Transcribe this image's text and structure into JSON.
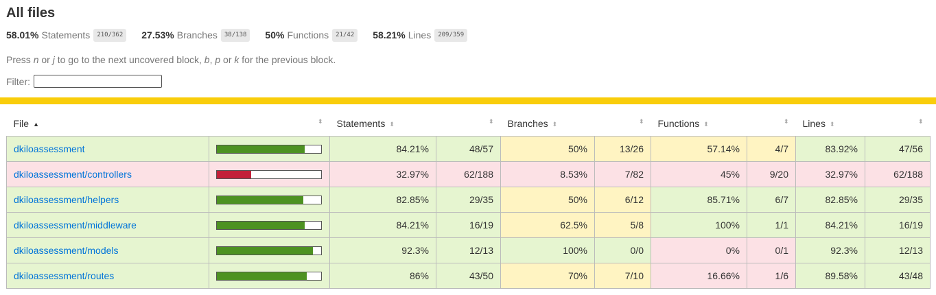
{
  "title": "All files",
  "summary": [
    {
      "pct": "58.01%",
      "label": "Statements",
      "frac": "210/362"
    },
    {
      "pct": "27.53%",
      "label": "Branches",
      "frac": "38/138"
    },
    {
      "pct": "50%",
      "label": "Functions",
      "frac": "21/42"
    },
    {
      "pct": "58.21%",
      "label": "Lines",
      "frac": "209/359"
    }
  ],
  "hint": {
    "p1": "Press ",
    "k1": "n",
    "p2": " or ",
    "k2": "j",
    "p3": " to go to the next uncovered block, ",
    "k3": "b",
    "p4": ", ",
    "k4": "p",
    "p5": " or ",
    "k5": "k",
    "p6": " for the previous block."
  },
  "filter": {
    "label": "Filter:",
    "value": ""
  },
  "colors": {
    "high": "#e6f5d0",
    "medium": "#fff4c2",
    "low": "#fce1e5",
    "bar_high": "#4d9221",
    "bar_low": "#c21f39",
    "status": "#f9cd0b",
    "link": "#0074D9"
  },
  "table": {
    "headers": {
      "file": "File",
      "statements": "Statements",
      "branches": "Branches",
      "functions": "Functions",
      "lines": "Lines"
    },
    "sort_up_icon": "▲",
    "sort_icon": "⬍",
    "rows": [
      {
        "file": "dkiloassessment",
        "level": "high",
        "bar_pct": 84.21,
        "statements": {
          "pct": "84.21%",
          "frac": "48/57",
          "level": "high"
        },
        "branches": {
          "pct": "50%",
          "frac": "13/26",
          "level": "medium"
        },
        "functions": {
          "pct": "57.14%",
          "frac": "4/7",
          "level": "medium"
        },
        "lines": {
          "pct": "83.92%",
          "frac": "47/56",
          "level": "high"
        }
      },
      {
        "file": "dkiloassessment/controllers",
        "level": "low",
        "bar_pct": 32.97,
        "statements": {
          "pct": "32.97%",
          "frac": "62/188",
          "level": "low"
        },
        "branches": {
          "pct": "8.53%",
          "frac": "7/82",
          "level": "low"
        },
        "functions": {
          "pct": "45%",
          "frac": "9/20",
          "level": "low"
        },
        "lines": {
          "pct": "32.97%",
          "frac": "62/188",
          "level": "low"
        }
      },
      {
        "file": "dkiloassessment/helpers",
        "level": "high",
        "bar_pct": 82.85,
        "statements": {
          "pct": "82.85%",
          "frac": "29/35",
          "level": "high"
        },
        "branches": {
          "pct": "50%",
          "frac": "6/12",
          "level": "medium"
        },
        "functions": {
          "pct": "85.71%",
          "frac": "6/7",
          "level": "high"
        },
        "lines": {
          "pct": "82.85%",
          "frac": "29/35",
          "level": "high"
        }
      },
      {
        "file": "dkiloassessment/middleware",
        "level": "high",
        "bar_pct": 84.21,
        "statements": {
          "pct": "84.21%",
          "frac": "16/19",
          "level": "high"
        },
        "branches": {
          "pct": "62.5%",
          "frac": "5/8",
          "level": "medium"
        },
        "functions": {
          "pct": "100%",
          "frac": "1/1",
          "level": "high"
        },
        "lines": {
          "pct": "84.21%",
          "frac": "16/19",
          "level": "high"
        }
      },
      {
        "file": "dkiloassessment/models",
        "level": "high",
        "bar_pct": 92.3,
        "statements": {
          "pct": "92.3%",
          "frac": "12/13",
          "level": "high"
        },
        "branches": {
          "pct": "100%",
          "frac": "0/0",
          "level": "high"
        },
        "functions": {
          "pct": "0%",
          "frac": "0/1",
          "level": "low"
        },
        "lines": {
          "pct": "92.3%",
          "frac": "12/13",
          "level": "high"
        }
      },
      {
        "file": "dkiloassessment/routes",
        "level": "high",
        "bar_pct": 86,
        "statements": {
          "pct": "86%",
          "frac": "43/50",
          "level": "high"
        },
        "branches": {
          "pct": "70%",
          "frac": "7/10",
          "level": "medium"
        },
        "functions": {
          "pct": "16.66%",
          "frac": "1/6",
          "level": "low"
        },
        "lines": {
          "pct": "89.58%",
          "frac": "43/48",
          "level": "high"
        }
      }
    ]
  }
}
